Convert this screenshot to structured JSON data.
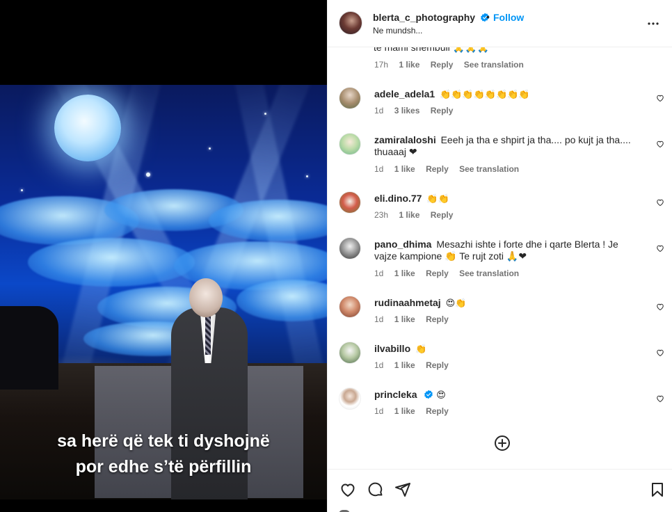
{
  "media": {
    "subtitle_line1": "sa herë që tek ti dyshojnë",
    "subtitle_line2": "por edhe s’të përfillin"
  },
  "header": {
    "username": "blerta_c_photography",
    "verified": true,
    "dot": "•",
    "follow_label": "Follow",
    "subtitle": "Ne mundsh...",
    "more_icon": "more-horizontal-icon"
  },
  "partial_comment": {
    "text": "te mami shembull 🙏🙏🙏",
    "time": "17h",
    "likes": "1 like",
    "reply": "Reply",
    "translate": "See translation"
  },
  "comments": [
    {
      "username": "adele_adela1",
      "text": "👏👏👏👏👏👏👏👏",
      "time": "1d",
      "likes": "3 likes",
      "reply": "Reply",
      "translate": ""
    },
    {
      "username": "zamiralaloshi",
      "text": "Eeeh ja tha e shpirt ja tha.... po kujt ja tha.... thuaaaj ❤",
      "time": "1d",
      "likes": "1 like",
      "reply": "Reply",
      "translate": "See translation"
    },
    {
      "username": "eli.dino.77",
      "text": "👏👏",
      "time": "23h",
      "likes": "1 like",
      "reply": "Reply",
      "translate": ""
    },
    {
      "username": "pano_dhima",
      "text": "Mesazhi ishte i forte dhe i qarte Blerta ! Je vajze kampione 👏 Te rujt zoti 🙏❤",
      "time": "1d",
      "likes": "1 like",
      "reply": "Reply",
      "translate": "See translation"
    },
    {
      "username": "rudinaahmetaj",
      "text": "😍👏",
      "time": "1d",
      "likes": "1 like",
      "reply": "Reply",
      "translate": ""
    },
    {
      "username": "ilvabillo",
      "text": "👏",
      "time": "1d",
      "likes": "1 like",
      "reply": "Reply",
      "translate": ""
    },
    {
      "username": "princleka",
      "text": "😍",
      "time": "1d",
      "likes": "1 like",
      "reply": "Reply",
      "translate": "",
      "verified": true
    }
  ],
  "colors": {
    "accent": "#0095f6",
    "text": "#262626",
    "secondary": "#737373",
    "border": "#efefef"
  },
  "icons": {
    "heart": "heart-icon",
    "comment": "comment-icon",
    "share": "share-icon",
    "save": "bookmark-icon",
    "load_more": "plus-circle-icon"
  }
}
